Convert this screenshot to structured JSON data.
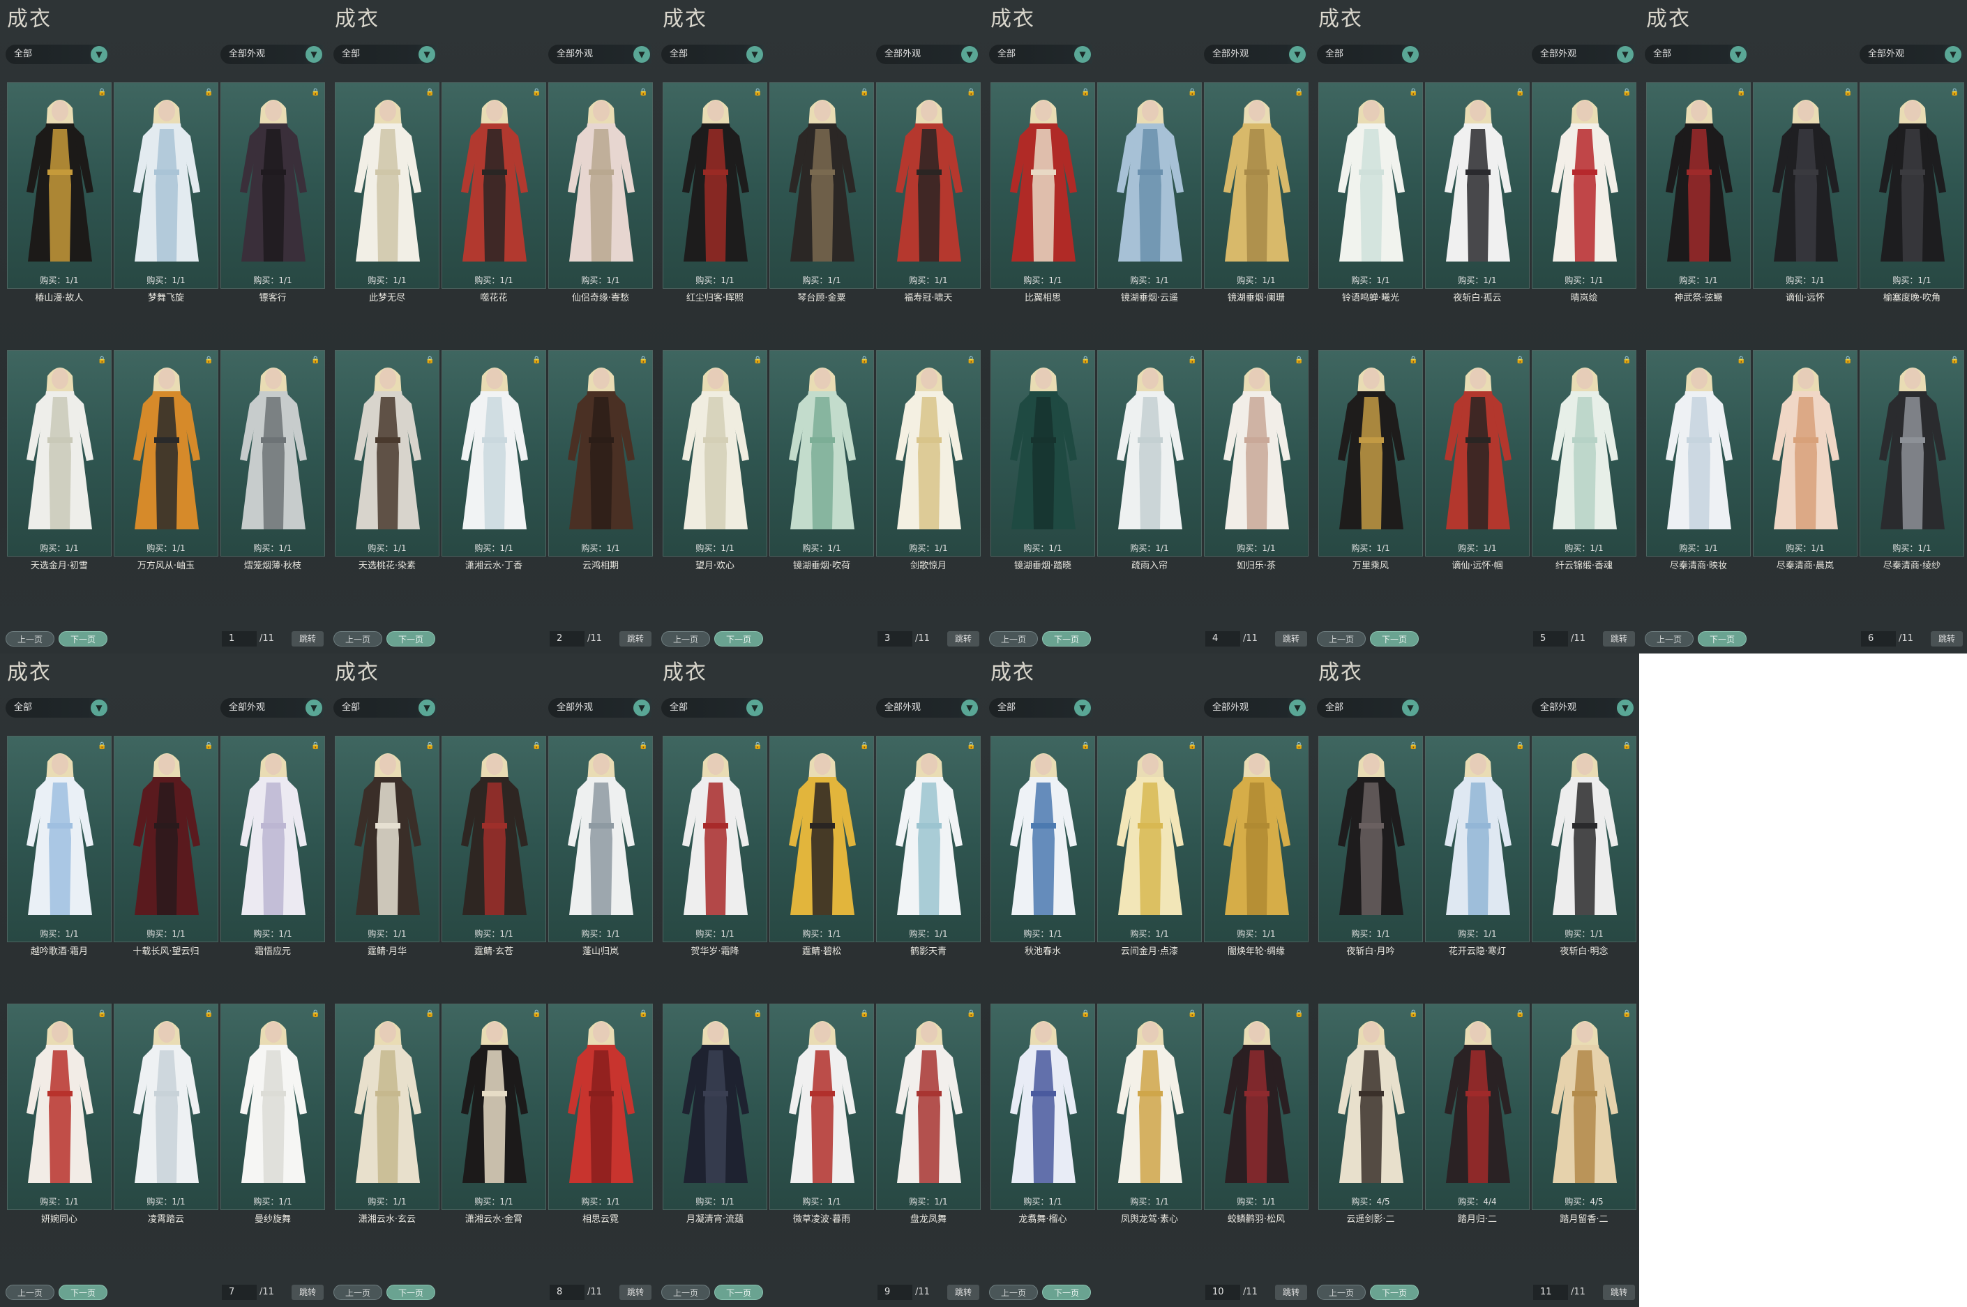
{
  "common": {
    "title": "成衣",
    "filter1": "全部",
    "filter2": "全部外观",
    "prev": "上一页",
    "next": "下一页",
    "jump": "跳转",
    "arrow": "▼",
    "buy_prefix": "购买："
  },
  "pages": [
    {
      "page": "1",
      "total": "/11",
      "items": [
        {
          "name": "椿山漫·故人",
          "buy": "1/1",
          "colors": [
            "#1c1a18",
            "#c59a3a"
          ]
        },
        {
          "name": "梦舞飞旋",
          "buy": "1/1",
          "colors": [
            "#e3ebf0",
            "#aac4d6"
          ]
        },
        {
          "name": "镖客行",
          "buy": "1/1",
          "colors": [
            "#3a2f3a",
            "#1f1a1f"
          ]
        },
        {
          "name": "天选金月·初雪",
          "buy": "1/1",
          "colors": [
            "#eeeeea",
            "#c9c9b8"
          ]
        },
        {
          "name": "万方风从·岫玉",
          "buy": "1/1",
          "colors": [
            "#d68a2a",
            "#2a2a2a"
          ]
        },
        {
          "name": "熠笼烟薄·秋枝",
          "buy": "1/1",
          "colors": [
            "#c7cccc",
            "#6d7376"
          ]
        }
      ]
    },
    {
      "page": "2",
      "total": "/11",
      "items": [
        {
          "name": "此梦无尽",
          "buy": "1/1",
          "colors": [
            "#f2efe6",
            "#cfc6a8"
          ]
        },
        {
          "name": "噬花花",
          "buy": "1/1",
          "colors": [
            "#b2392f",
            "#2a2624"
          ]
        },
        {
          "name": "仙侣奇缘·寄愁",
          "buy": "1/1",
          "colors": [
            "#e7d6d0",
            "#b9a890"
          ]
        },
        {
          "name": "天选桃花·染素",
          "buy": "1/1",
          "colors": [
            "#d8d4cc",
            "#4a3a2e"
          ]
        },
        {
          "name": "潇湘云水·丁香",
          "buy": "1/1",
          "colors": [
            "#f1f3f4",
            "#cad8de"
          ]
        },
        {
          "name": "云鸿相期",
          "buy": "1/1",
          "colors": [
            "#4a3024",
            "#2b1d17"
          ]
        }
      ]
    },
    {
      "page": "3",
      "total": "/11",
      "items": [
        {
          "name": "红尘归客·晖照",
          "buy": "1/1",
          "colors": [
            "#1d1c1c",
            "#9a2a24"
          ]
        },
        {
          "name": "琴台顾·金粟",
          "buy": "1/1",
          "colors": [
            "#2b2725",
            "#7a6a50"
          ]
        },
        {
          "name": "福寿冠·啸天",
          "buy": "1/1",
          "colors": [
            "#b5382e",
            "#2b2523"
          ]
        },
        {
          "name": "望月·欢心",
          "buy": "1/1",
          "colors": [
            "#f0ede0",
            "#d4cfb6"
          ]
        },
        {
          "name": "镜湖垂烟·吹荷",
          "buy": "1/1",
          "colors": [
            "#c3dccc",
            "#7cae96"
          ]
        },
        {
          "name": "剑歌惊月",
          "buy": "1/1",
          "colors": [
            "#f4f0e2",
            "#d8c48a"
          ]
        }
      ]
    },
    {
      "page": "4",
      "total": "/11",
      "items": [
        {
          "name": "比翼相思",
          "buy": "1/1",
          "colors": [
            "#b02a26",
            "#e8d8c4"
          ]
        },
        {
          "name": "镜湖垂烟·云遥",
          "buy": "1/1",
          "colors": [
            "#a7c1d6",
            "#6a90ad"
          ]
        },
        {
          "name": "镜湖垂烟·阑珊",
          "buy": "1/1",
          "colors": [
            "#d8b96a",
            "#a88a48"
          ]
        },
        {
          "name": "镜湖垂烟·踏晓",
          "buy": "1/1",
          "colors": [
            "#1f4a42",
            "#16332e"
          ]
        },
        {
          "name": "疏雨入帘",
          "buy": "1/1",
          "colors": [
            "#eef1f1",
            "#c4d0d2"
          ]
        },
        {
          "name": "如归乐·茶",
          "buy": "1/1",
          "colors": [
            "#f2eee8",
            "#c9a898"
          ]
        }
      ]
    },
    {
      "page": "5",
      "total": "/11",
      "items": [
        {
          "name": "铃语鸣蝉·曦光",
          "buy": "1/1",
          "colors": [
            "#f1f3ee",
            "#cfe0da"
          ]
        },
        {
          "name": "夜斩白·孤云",
          "buy": "1/1",
          "colors": [
            "#f0f0f0",
            "#2a2a2e"
          ]
        },
        {
          "name": "晴岚绘",
          "buy": "1/1",
          "colors": [
            "#f3efe8",
            "#b6282c"
          ]
        },
        {
          "name": "万里乘风",
          "buy": "1/1",
          "colors": [
            "#1e1c1b",
            "#c29a44"
          ]
        },
        {
          "name": "谪仙·远怀·帼",
          "buy": "1/1",
          "colors": [
            "#b3372d",
            "#2a2523"
          ]
        },
        {
          "name": "纤云锦缎·香魂",
          "buy": "1/1",
          "colors": [
            "#e7efe8",
            "#b6d2c6"
          ]
        }
      ]
    },
    {
      "page": "6",
      "total": "/11",
      "items": [
        {
          "name": "神武祭·弦鳜",
          "buy": "1/1",
          "colors": [
            "#1c1a1b",
            "#9e2a2a"
          ]
        },
        {
          "name": "谪仙·远怀",
          "buy": "1/1",
          "colors": [
            "#1f1f22",
            "#3a3a3f"
          ]
        },
        {
          "name": "榆塞度晚·吹角",
          "buy": "1/1",
          "colors": [
            "#1d1d1f",
            "#3b3b3f"
          ]
        },
        {
          "name": "尽秦清商·映妆",
          "buy": "1/1",
          "colors": [
            "#eef1f4",
            "#c6d4de"
          ]
        },
        {
          "name": "尽秦清商·晨岚",
          "buy": "1/1",
          "colors": [
            "#f0d7c6",
            "#d8a17a"
          ]
        },
        {
          "name": "尽秦清商·绫纱",
          "buy": "1/1",
          "colors": [
            "#2a2b2e",
            "#8d9197"
          ]
        }
      ]
    },
    {
      "page": "7",
      "total": "/11",
      "items": [
        {
          "name": "越吟歌酒·霜月",
          "buy": "1/1",
          "colors": [
            "#eaf0f6",
            "#9fbfe0"
          ]
        },
        {
          "name": "十载长风·望云归",
          "buy": "1/1",
          "colors": [
            "#5a1a1e",
            "#2a1a1c"
          ]
        },
        {
          "name": "霜悟应元",
          "buy": "1/1",
          "colors": [
            "#eceaf2",
            "#bcb6d2"
          ]
        },
        {
          "name": "妍婉同心",
          "buy": "1/1",
          "colors": [
            "#f2ece6",
            "#b8322c"
          ]
        },
        {
          "name": "凌霄踏云",
          "buy": "1/1",
          "colors": [
            "#eef1f3",
            "#c8d2d8"
          ]
        },
        {
          "name": "曼纱旋舞",
          "buy": "1/1",
          "colors": [
            "#f6f6f4",
            "#dcdcd6"
          ]
        }
      ]
    },
    {
      "page": "8",
      "total": "/11",
      "items": [
        {
          "name": "霆鲭·月华",
          "buy": "1/1",
          "colors": [
            "#3a2e28",
            "#e6e0d2"
          ]
        },
        {
          "name": "霆鲭·玄苍",
          "buy": "1/1",
          "colors": [
            "#2e2622",
            "#9e2f2a"
          ]
        },
        {
          "name": "蓬山归岚",
          "buy": "1/1",
          "colors": [
            "#eef0f0",
            "#8e9aa2"
          ]
        },
        {
          "name": "潇湘云水·玄云",
          "buy": "1/1",
          "colors": [
            "#e8e0cc",
            "#c6b88e"
          ]
        },
        {
          "name": "潇湘云水·金霄",
          "buy": "1/1",
          "colors": [
            "#1c1a1a",
            "#e6dcc6"
          ]
        },
        {
          "name": "相思云霓",
          "buy": "1/1",
          "colors": [
            "#c8342e",
            "#8a1e1c"
          ]
        }
      ]
    },
    {
      "page": "9",
      "total": "/11",
      "items": [
        {
          "name": "贺华岁·霜降",
          "buy": "1/1",
          "colors": [
            "#eeeeee",
            "#a82a2a"
          ]
        },
        {
          "name": "霆鲭·碧松",
          "buy": "1/1",
          "colors": [
            "#e2b53c",
            "#2a2522"
          ]
        },
        {
          "name": "鹤影天青",
          "buy": "1/1",
          "colors": [
            "#f1f4f6",
            "#9cc4d0"
          ]
        },
        {
          "name": "月凝清宵·流蕴",
          "buy": "1/1",
          "colors": [
            "#1e2230",
            "#3a3f52"
          ]
        },
        {
          "name": "微草凌波·暮雨",
          "buy": "1/1",
          "colors": [
            "#f0f0f0",
            "#b1302c"
          ]
        },
        {
          "name": "盘龙凤舞",
          "buy": "1/1",
          "colors": [
            "#f2efec",
            "#a83532"
          ]
        }
      ]
    },
    {
      "page": "10",
      "total": "/11",
      "items": [
        {
          "name": "秋池春水",
          "buy": "1/1",
          "colors": [
            "#eef2f6",
            "#4c7ab0"
          ]
        },
        {
          "name": "云间金月·点漆",
          "buy": "1/1",
          "colors": [
            "#f2e6b8",
            "#d8b852"
          ]
        },
        {
          "name": "闇焕年轮·绸缘",
          "buy": "1/1",
          "colors": [
            "#d6ad48",
            "#b08a32"
          ]
        },
        {
          "name": "龙翥舞·榴心",
          "buy": "1/1",
          "colors": [
            "#e8ecf6",
            "#4a5a9e"
          ]
        },
        {
          "name": "凤舆龙驾·素心",
          "buy": "1/1",
          "colors": [
            "#f4f1e8",
            "#cfa64a"
          ]
        },
        {
          "name": "蛟鳞鹳羽·松风",
          "buy": "1/1",
          "colors": [
            "#2a1f22",
            "#8e2a2e"
          ]
        }
      ]
    },
    {
      "page": "11",
      "total": "/11",
      "items": [
        {
          "name": "夜斩白·月吟",
          "buy": "1/1",
          "colors": [
            "#1e1c1d",
            "#6a6060"
          ]
        },
        {
          "name": "花开云隐·寒灯",
          "buy": "1/1",
          "colors": [
            "#dfe8f2",
            "#93b6d6"
          ]
        },
        {
          "name": "夜斩白·明念",
          "buy": "1/1",
          "colors": [
            "#ededed",
            "#2a2a2c"
          ]
        },
        {
          "name": "云遥剑影·二",
          "buy": "4/5",
          "colors": [
            "#e8e0cc",
            "#3a302a"
          ]
        },
        {
          "name": "踏月归·二",
          "buy": "4/4",
          "colors": [
            "#2a2224",
            "#a02a2a"
          ]
        },
        {
          "name": "踏月留香·二",
          "buy": "4/5",
          "colors": [
            "#e6d2ac",
            "#b28a4a"
          ]
        }
      ]
    }
  ]
}
